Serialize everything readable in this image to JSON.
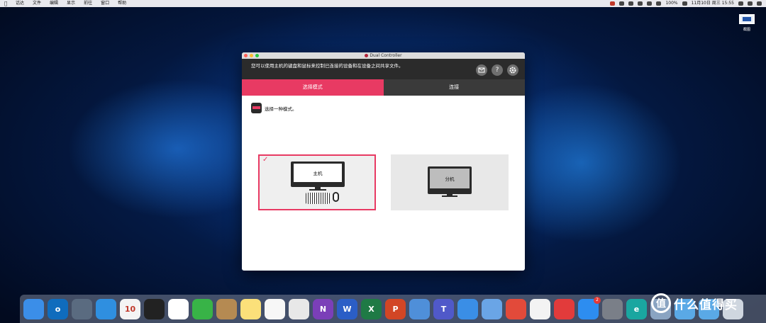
{
  "menubar": {
    "items": [
      "话达",
      "文件",
      "编辑",
      "显示",
      "前往",
      "窗口",
      "帮助"
    ],
    "battery": "100%",
    "datetime": "11月10日 周三 15:55"
  },
  "desktop": {
    "icon_label": "截图"
  },
  "window": {
    "title": "Dual Controller",
    "description": "您可以使用主机的键盘和鼠标来控制已连接的设备和在设备之间共享文件。",
    "header_buttons": [
      "support-icon",
      "help-icon",
      "settings-icon"
    ],
    "help_glyph": "?",
    "tabs": [
      {
        "label": "选择模式",
        "active": true
      },
      {
        "label": "连接",
        "active": false
      }
    ],
    "prompt": "选择一种模式。",
    "modes": {
      "master": {
        "label": "主机",
        "selected": true
      },
      "slave": {
        "label": "分机",
        "selected": false
      }
    },
    "accent_color": "#e83a63"
  },
  "dock": {
    "apps": [
      {
        "name": "finder-icon",
        "color": "#3b8ee8"
      },
      {
        "name": "outlook-icon",
        "color": "#0f6cbd",
        "glyph": "o"
      },
      {
        "name": "launchpad-icon",
        "color": "#5a6b80"
      },
      {
        "name": "safari-icon",
        "color": "#2f8fe0"
      },
      {
        "name": "calendar-icon",
        "color": "#f4f4f4",
        "glyph": "10"
      },
      {
        "name": "qq-icon",
        "color": "#222222"
      },
      {
        "name": "baidu-netdisk-icon",
        "color": "#ffffff"
      },
      {
        "name": "wechat-icon",
        "color": "#38b347"
      },
      {
        "name": "contacts-icon",
        "color": "#b58a52"
      },
      {
        "name": "notes-icon",
        "color": "#fbe07a"
      },
      {
        "name": "reminders-icon",
        "color": "#f7f7f7"
      },
      {
        "name": "chrome-icon",
        "color": "#e8e8e8"
      },
      {
        "name": "onenote-icon",
        "color": "#7b3fb8",
        "glyph": "N"
      },
      {
        "name": "word-icon",
        "color": "#2b5ec6",
        "glyph": "W"
      },
      {
        "name": "excel-icon",
        "color": "#1f7a45",
        "glyph": "X"
      },
      {
        "name": "powerpoint-icon",
        "color": "#d24625",
        "glyph": "P"
      },
      {
        "name": "quicktime-icon",
        "color": "#4f8fd9"
      },
      {
        "name": "teams-icon",
        "color": "#5059c9",
        "glyph": "T"
      },
      {
        "name": "keynote-icon",
        "color": "#3a8ee6"
      },
      {
        "name": "preview-icon",
        "color": "#6aa5e6"
      },
      {
        "name": "xmind-icon",
        "color": "#e24a3a"
      },
      {
        "name": "photos-icon",
        "color": "#f3f3f3"
      },
      {
        "name": "netease-music-icon",
        "color": "#e23b3b"
      },
      {
        "name": "app-store-icon",
        "color": "#2d8df0",
        "badge": "2"
      },
      {
        "name": "system-preferences-icon",
        "color": "#7a7f88"
      },
      {
        "name": "eudic-icon",
        "color": "#1aa6a0",
        "glyph": "e"
      },
      {
        "name": "image-capture-icon",
        "color": "#8aa4c2"
      },
      {
        "name": "downloads-folder-icon",
        "color": "#5aa9e6"
      },
      {
        "name": "documents-folder-icon",
        "color": "#5aa9e6"
      },
      {
        "name": "trash-icon",
        "color": "#cfd6df"
      }
    ]
  },
  "watermark": {
    "text": "什么值得买",
    "logo_glyph": "值"
  }
}
